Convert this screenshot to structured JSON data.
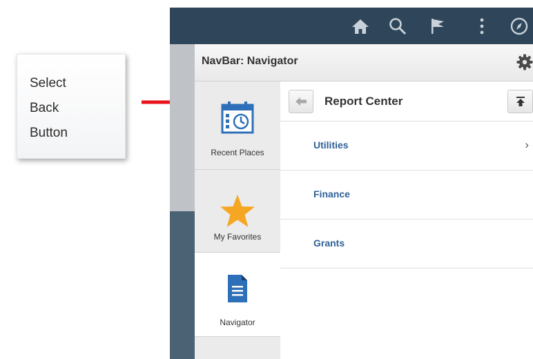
{
  "callout": {
    "text": "Select\nBack\nButton"
  },
  "topbar": {
    "icons": [
      "home-icon",
      "search-icon",
      "flag-icon",
      "more-vertical-icon",
      "compass-icon"
    ]
  },
  "navbar": {
    "title": "NavBar: Navigator",
    "tiles": [
      {
        "label": "Recent Places",
        "icon": "recent-places-icon"
      },
      {
        "label": "My Favorites",
        "icon": "star-icon"
      },
      {
        "label": "Navigator",
        "icon": "navigator-document-icon"
      }
    ]
  },
  "content": {
    "title": "Report Center",
    "items": [
      {
        "label": "Utilities",
        "has_children": true
      },
      {
        "label": "Finance",
        "has_children": false
      },
      {
        "label": "Grants",
        "has_children": false
      }
    ]
  },
  "colors": {
    "topbar": "#2f4559",
    "accent_link": "#2e6099",
    "arrow": "#e8141b",
    "favorite_star": "#f5a623",
    "tile_icon": "#2d6fb8"
  }
}
